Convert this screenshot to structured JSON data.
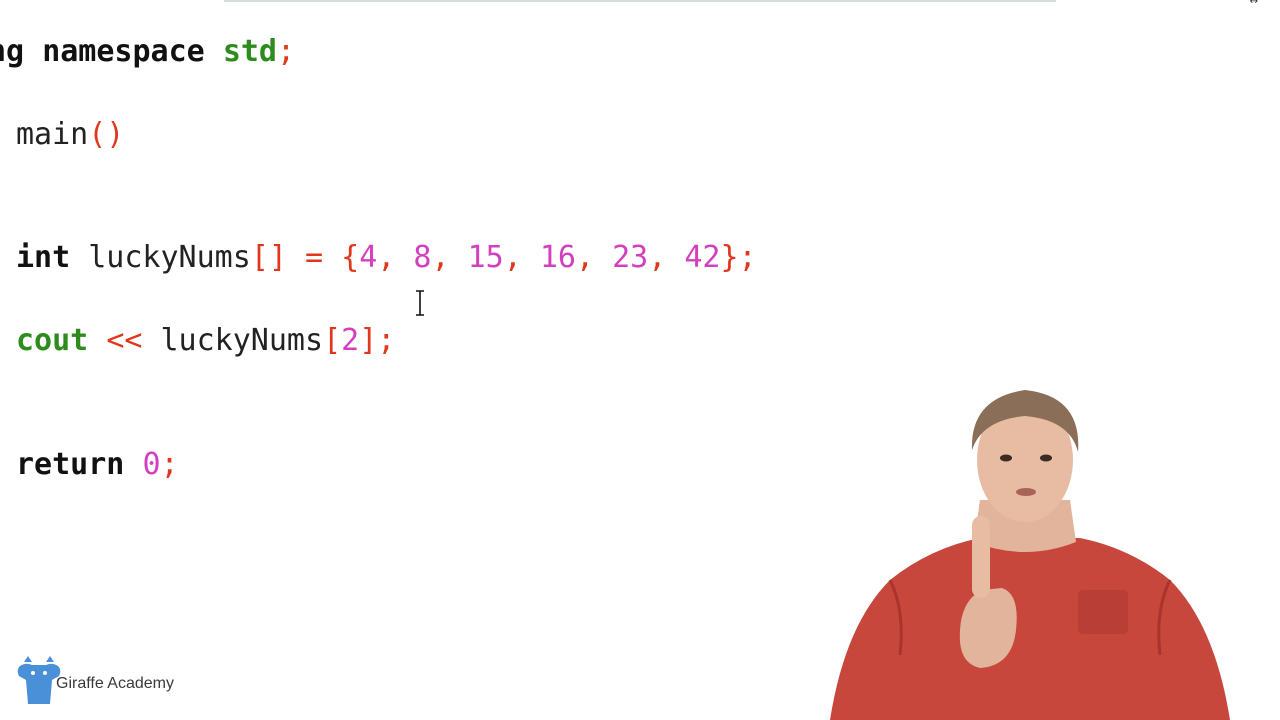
{
  "editor": {
    "lines": [
      [
        {
          "t": "ng ",
          "c": "kw"
        },
        {
          "t": "namespace ",
          "c": "kw"
        },
        {
          "t": "std",
          "c": "ty"
        },
        {
          "t": ";",
          "c": "pn"
        }
      ],
      [
        {
          "t": "main",
          "c": "id"
        },
        {
          "t": "()",
          "c": "pn"
        }
      ],
      [
        {
          "t": "int ",
          "c": "kw"
        },
        {
          "t": "luckyNums",
          "c": "id"
        },
        {
          "t": "[] = {",
          "c": "pn"
        },
        {
          "t": "4",
          "c": "nm"
        },
        {
          "t": ", ",
          "c": "pn"
        },
        {
          "t": "8",
          "c": "nm"
        },
        {
          "t": ", ",
          "c": "pn"
        },
        {
          "t": "15",
          "c": "nm"
        },
        {
          "t": ", ",
          "c": "pn"
        },
        {
          "t": "16",
          "c": "nm"
        },
        {
          "t": ", ",
          "c": "pn"
        },
        {
          "t": "23",
          "c": "nm"
        },
        {
          "t": ", ",
          "c": "pn"
        },
        {
          "t": "42",
          "c": "nm"
        },
        {
          "t": "};",
          "c": "pn"
        }
      ],
      [
        {
          "t": "cout ",
          "c": "fn"
        },
        {
          "t": "<< ",
          "c": "pn"
        },
        {
          "t": "luckyNums",
          "c": "id"
        },
        {
          "t": "[",
          "c": "pn"
        },
        {
          "t": "2",
          "c": "nm"
        },
        {
          "t": "];",
          "c": "pn"
        }
      ],
      [
        {
          "t": "return ",
          "c": "kw"
        },
        {
          "t": "0",
          "c": "nm"
        },
        {
          "t": ";",
          "c": "pn"
        }
      ]
    ]
  },
  "colors": {
    "keyword": "#111111",
    "type": "#2e8b1e",
    "punctuation": "#e0361c",
    "number": "#d43fbf",
    "identifier": "#222222",
    "brand": "#4a90d9"
  },
  "icons": {
    "cursor": "text-cursor-icon",
    "logo": "giraffe-logo-icon",
    "corner": "resize-arrows-icon"
  },
  "watermark": {
    "label": "Giraffe Academy"
  },
  "window": {
    "corner_glyph": "↔"
  }
}
